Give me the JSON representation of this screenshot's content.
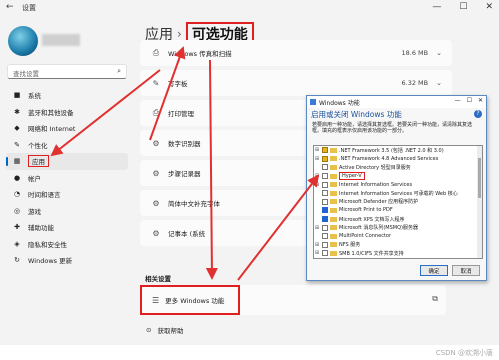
{
  "window": {
    "title": "设置",
    "controls": [
      "—",
      "☐",
      "✕"
    ]
  },
  "sidebar": {
    "search_placeholder": "查找设置",
    "items": [
      {
        "label": "系统",
        "icon": "■"
      },
      {
        "label": "蓝牙和其他设备",
        "icon": "✱"
      },
      {
        "label": "网络和 Internet",
        "icon": "◆"
      },
      {
        "label": "个性化",
        "icon": "✎"
      },
      {
        "label": "应用",
        "icon": "▦",
        "active": true
      },
      {
        "label": "帐户",
        "icon": "●"
      },
      {
        "label": "时间和语言",
        "icon": "◔"
      },
      {
        "label": "游戏",
        "icon": "◎"
      },
      {
        "label": "辅助功能",
        "icon": "✚"
      },
      {
        "label": "隐私和安全性",
        "icon": "◈"
      },
      {
        "label": "Windows 更新",
        "icon": "↻"
      }
    ]
  },
  "breadcrumb": {
    "parent": "应用",
    "separator": "›",
    "current": "可选功能"
  },
  "features": [
    {
      "label": "Windows 传真和扫描",
      "size": "18.6 MB",
      "icon": "⎙"
    },
    {
      "label": "写字板",
      "size": "6.32 MB",
      "icon": "✎"
    },
    {
      "label": "打印管理",
      "size": "",
      "icon": "⎙"
    },
    {
      "label": "数字识别器",
      "size": "",
      "icon": "⚙"
    },
    {
      "label": "步骤记录器",
      "size": "",
      "icon": "⚙"
    },
    {
      "label": "简体中文补充字体",
      "size": "",
      "icon": "⚙"
    },
    {
      "label": "记事本 (系统",
      "size": "",
      "icon": "⚙"
    }
  ],
  "related": {
    "title": "相关设置",
    "more_features": "更多 Windows 功能",
    "help": "获取帮助"
  },
  "dialog": {
    "title": "Windows 功能",
    "header": "启用或关闭 Windows 功能",
    "description": "若要启用一种功能，请选择其复选框。若要关闭一种功能，请清除其复选框。填充的框表示仅启用该功能的一部分。",
    "items": [
      {
        "label": ".NET Framework 3.5 (包括 .NET 2.0 和 3.0)",
        "expand": "⊞",
        "state": "partial"
      },
      {
        "label": ".NET Framework 4.8 Advanced Services",
        "expand": "⊞",
        "state": "partial"
      },
      {
        "label": "Active Directory 轻型目录服务",
        "expand": "",
        "state": "none"
      },
      {
        "label": "Hyper-V",
        "expand": "⊞",
        "state": "none",
        "highlight": true
      },
      {
        "label": "Internet Information Services",
        "expand": "⊞",
        "state": "none"
      },
      {
        "label": "Internet Information Services 可承载的 Web 核心",
        "expand": "",
        "state": "none"
      },
      {
        "label": "Microsoft Defender 应用程序防护",
        "expand": "",
        "state": "none"
      },
      {
        "label": "Microsoft Print to PDF",
        "expand": "",
        "state": "full"
      },
      {
        "label": "Microsoft XPS 文档写入程序",
        "expand": "",
        "state": "full"
      },
      {
        "label": "Microsoft 消息队列(MSMQ)服务器",
        "expand": "⊞",
        "state": "none"
      },
      {
        "label": "MultiPoint Connector",
        "expand": "",
        "state": "none"
      },
      {
        "label": "NFS 服务",
        "expand": "⊞",
        "state": "none"
      },
      {
        "label": "SMB 1.0/CIFS 文件共享支持",
        "expand": "⊞",
        "state": "none"
      }
    ],
    "ok": "确定",
    "cancel": "取消"
  },
  "watermark": "CSDN @欢溯小唐",
  "colors": {
    "accent": "#0067c0",
    "highlight": "#e02020",
    "arrow": "#e03030"
  }
}
